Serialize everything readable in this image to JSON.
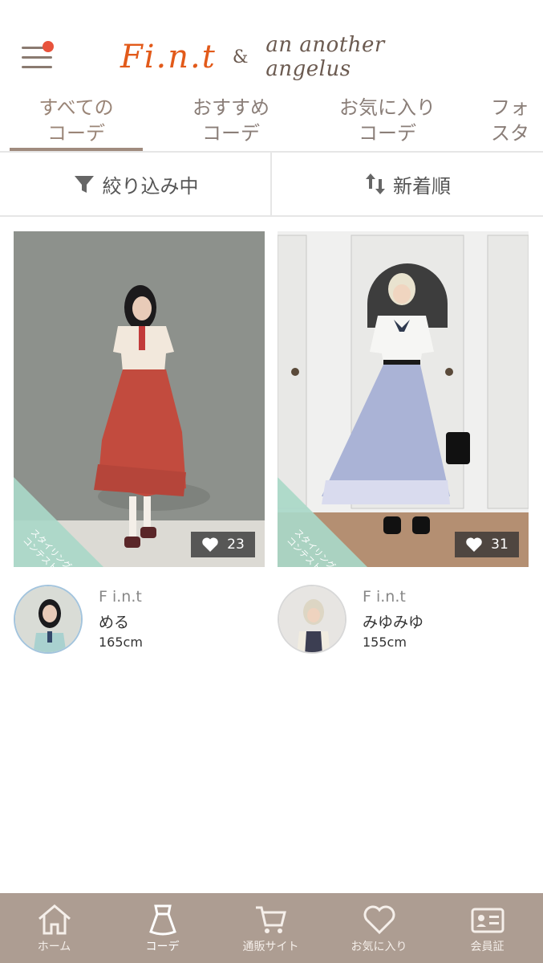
{
  "header": {
    "logo_primary": "Fi.n.t",
    "logo_amp": "&",
    "logo_secondary": "an another angelus"
  },
  "tabs": [
    {
      "line1": "すべての",
      "line2": "コーデ",
      "active": true
    },
    {
      "line1": "おすすめ",
      "line2": "コーデ",
      "active": false
    },
    {
      "line1": "お気に入り",
      "line2": "コーデ",
      "active": false
    },
    {
      "line1": "フォ",
      "line2": "スタ",
      "active": false
    }
  ],
  "filters": {
    "filter_label": "絞り込み中",
    "sort_label": "新着順"
  },
  "cards": [
    {
      "likes": "23",
      "ribbon_line1": "スタイリング",
      "ribbon_line2": "コンテスト",
      "brand": "F i.n.t",
      "name": "める",
      "height": "165cm"
    },
    {
      "likes": "31",
      "ribbon_line1": "スタイリング",
      "ribbon_line2": "コンテスト",
      "brand": "F i.n.t",
      "name": "みゆみゆ",
      "height": "155cm"
    }
  ],
  "bottom_nav": [
    {
      "label": "ホーム",
      "icon": "home-icon"
    },
    {
      "label": "コーデ",
      "icon": "dress-icon"
    },
    {
      "label": "通販サイト",
      "icon": "cart-icon"
    },
    {
      "label": "お気に入り",
      "icon": "heart-icon"
    },
    {
      "label": "会員証",
      "icon": "member-card-icon"
    }
  ],
  "colors": {
    "accent": "#a08b7e",
    "nav_bg": "#ad9d92",
    "logo_orange": "#e25a1a",
    "ribbon": "#a9d8c8"
  }
}
